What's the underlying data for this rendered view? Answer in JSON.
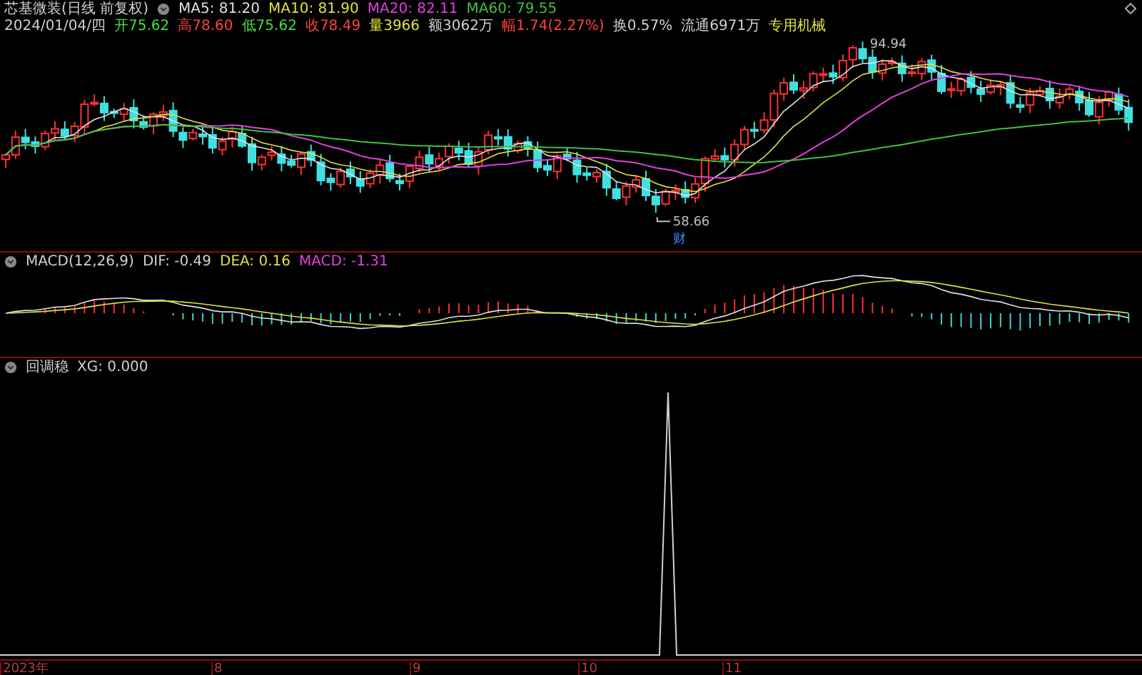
{
  "price_panel": {
    "title": "芯基微装(日线 前复权)",
    "moving_averages": [
      {
        "text": "MA5: 81.20",
        "color": "#e0e0e0"
      },
      {
        "text": "MA10: 81.90",
        "color": "#e0e040"
      },
      {
        "text": "MA20: 82.11",
        "color": "#e040e0"
      },
      {
        "text": "MA60: 79.55",
        "color": "#40c040"
      }
    ],
    "date": "2024/01/04/四",
    "quote": [
      {
        "text": "开75.62",
        "color": "#40e040"
      },
      {
        "text": "高78.60",
        "color": "#ff4040"
      },
      {
        "text": "低75.62",
        "color": "#40e040"
      },
      {
        "text": "收78.49",
        "color": "#ff4040"
      },
      {
        "text": "量3966",
        "color": "#e0e040"
      },
      {
        "text": "额3062万",
        "color": "#d0d0d0"
      },
      {
        "text": "幅1.74(2.27%)",
        "color": "#ff4040"
      },
      {
        "text": "换0.57%",
        "color": "#d0d0d0"
      },
      {
        "text": "流通6971万",
        "color": "#d0d0d0"
      },
      {
        "text": "专用机械",
        "color": "#e0e040"
      }
    ],
    "high_label": "94.94",
    "low_label": "58.66",
    "event_marker": "财"
  },
  "macd_panel": {
    "title": "MACD(12,26,9)",
    "values": [
      {
        "text": "DIF: -0.49",
        "color": "#d0d0d0"
      },
      {
        "text": "DEA: 0.16",
        "color": "#e0e040"
      },
      {
        "text": "MACD: -1.31",
        "color": "#e040e0"
      }
    ]
  },
  "signal_panel": {
    "title": "回调稳",
    "value": "XG: 0.000"
  },
  "time_axis": [
    {
      "label": "2023年"
    },
    {
      "label": "8"
    },
    {
      "label": "9"
    },
    {
      "label": "10"
    },
    {
      "label": "11"
    }
  ]
}
